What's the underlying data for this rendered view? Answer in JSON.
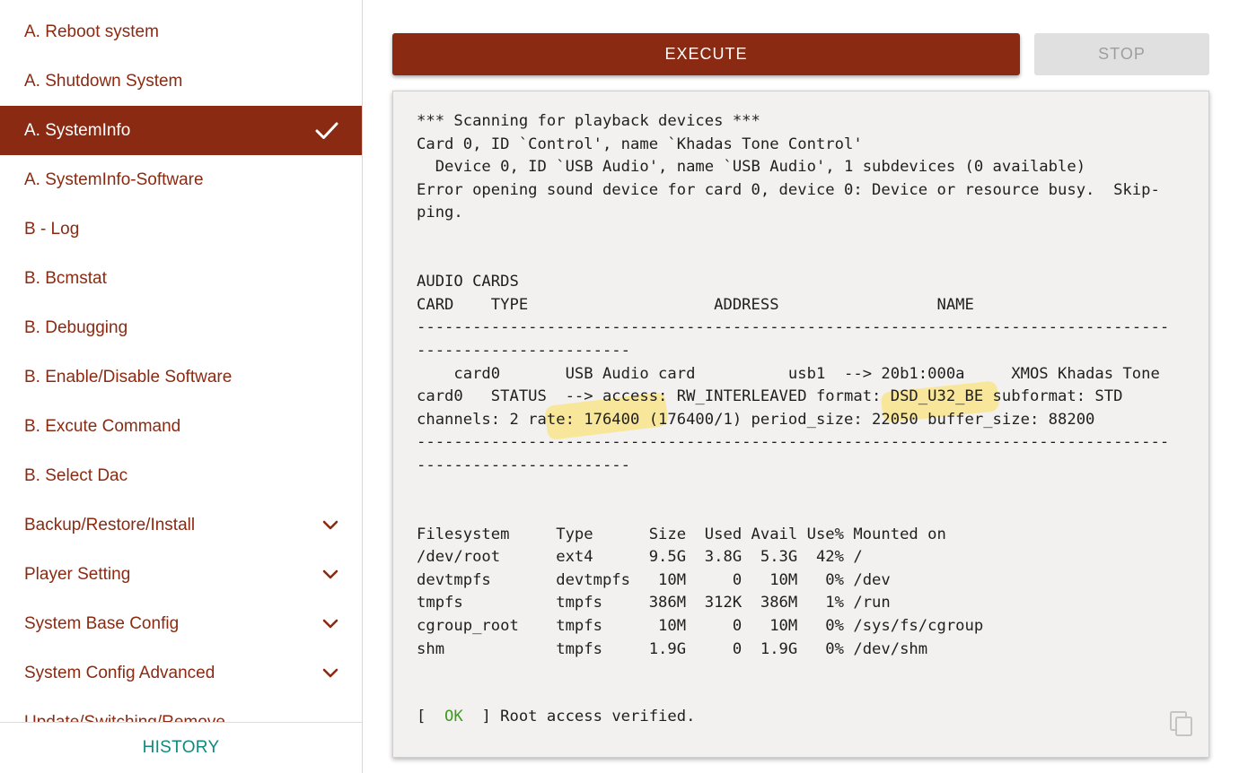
{
  "sidebar": {
    "items": [
      {
        "label": "A. Reboot system"
      },
      {
        "label": "A. Shutdown System"
      },
      {
        "label": "A. SystemInfo"
      },
      {
        "label": "A. SystemInfo-Software"
      },
      {
        "label": "B - Log"
      },
      {
        "label": "B. Bcmstat"
      },
      {
        "label": "B. Debugging"
      },
      {
        "label": "B. Enable/Disable Software"
      },
      {
        "label": "B. Excute Command"
      },
      {
        "label": "B. Select Dac"
      },
      {
        "label": "Backup/Restore/Install"
      },
      {
        "label": "Player Setting"
      },
      {
        "label": "System Base Config"
      },
      {
        "label": "System Config Advanced"
      },
      {
        "label": "Update/Switching/Remove"
      }
    ],
    "active_index": 2,
    "history_label": "HISTORY"
  },
  "main": {
    "execute_label": "EXECUTE",
    "stop_label": "STOP",
    "output": "*** Scanning for playback devices ***\nCard 0, ID `Control', name `Khadas Tone Control'\n  Device 0, ID `USB Audio', name `USB Audio', 1 subdevices (0 available)\nError opening sound device for card 0, device 0: Device or resource busy.  Skip-\nping.\n\n\nAUDIO CARDS\nCARD    TYPE                    ADDRESS                 NAME\n---------------------------------------------------------------------------------\n-----------------------\n    card0       USB Audio card          usb1  --> 20b1:000a     XMOS Khadas Tone\ncard0   STATUS  --> access: RW_INTERLEAVED format: DSD_U32_BE subformat: STD\nchannels: 2 rate: 176400 (176400/1) period_size: 22050 buffer_size: 88200\n---------------------------------------------------------------------------------\n-----------------------\n\n\nFilesystem     Type      Size  Used Avail Use% Mounted on\n/dev/root      ext4      9.5G  3.8G  5.3G  42% /\ndevtmpfs       devtmpfs   10M     0   10M   0% /dev\ntmpfs          tmpfs     386M  312K  386M   1% /run\ncgroup_root    tmpfs      10M     0   10M   0% /sys/fs/cgroup\nshm            tmpfs     1.9G     0  1.9G   0% /dev/shm",
    "status_open": "[  ",
    "status_ok": "OK",
    "status_close": "  ] Root access verified."
  },
  "colors": {
    "brand": "#8b2a12",
    "history": "#0f8b7d",
    "ok": "#3d9a1f",
    "highlight": "#fdde54"
  }
}
